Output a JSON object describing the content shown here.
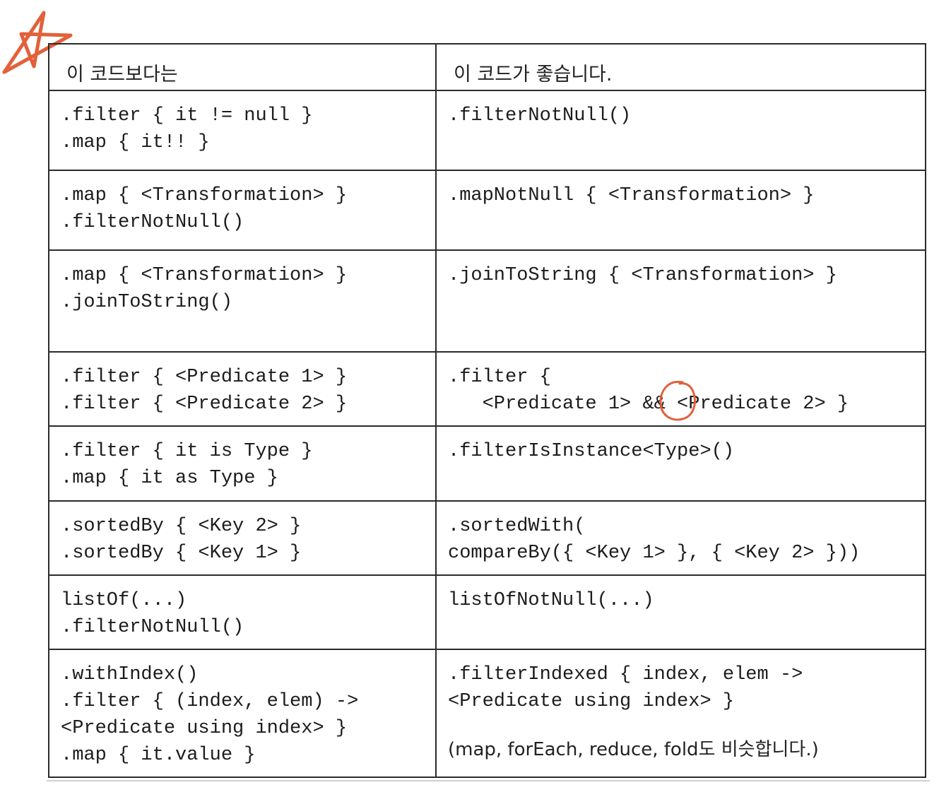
{
  "header": {
    "left": "이 코드보다는",
    "right": "이 코드가 좋습니다."
  },
  "rows": [
    {
      "left": [
        ".filter { it != null }",
        ".map { it!! }"
      ],
      "right": [
        ".filterNotNull()"
      ]
    },
    {
      "left": [
        ".map { <Transformation> }",
        ".filterNotNull()"
      ],
      "right": [
        ".mapNotNull { <Transformation> }"
      ]
    },
    {
      "left": [
        ".map { <Transformation> }",
        ".joinToString()"
      ],
      "right": [
        ".joinToString { <Transformation> }"
      ]
    },
    {
      "left": [
        ".filter { <Predicate 1> }",
        ".filter { <Predicate 2> }"
      ],
      "right": [
        ".filter {",
        "   <Predicate 1> && <Predicate 2> }"
      ]
    },
    {
      "left": [
        ".filter { it is Type }",
        ".map { it as Type }"
      ],
      "right": [
        ".filterIsInstance<Type>()"
      ]
    },
    {
      "left": [
        ".sortedBy { <Key 2> }",
        ".sortedBy { <Key 1> }"
      ],
      "right": [
        ".sortedWith(",
        "compareBy({ <Key 1> }, { <Key 2> }))"
      ]
    },
    {
      "left": [
        "listOf(...)",
        ".filterNotNull()"
      ],
      "right": [
        "listOfNotNull(...)"
      ]
    },
    {
      "left": [
        ".withIndex()",
        ".filter { (index, elem) ->",
        "<Predicate using index> }",
        ".map { it.value }"
      ],
      "right": [
        ".filterIndexed { index, elem ->",
        "<Predicate using index> }"
      ],
      "note": "(map, forEach, reduce, fold도 비슷합니다.)"
    }
  ],
  "colors": {
    "border": "#2b2b2b",
    "annotation": "#e2603a"
  },
  "icons": {
    "star": "hand-drawn-star-icon",
    "circle": "hand-drawn-circle-annotation"
  }
}
